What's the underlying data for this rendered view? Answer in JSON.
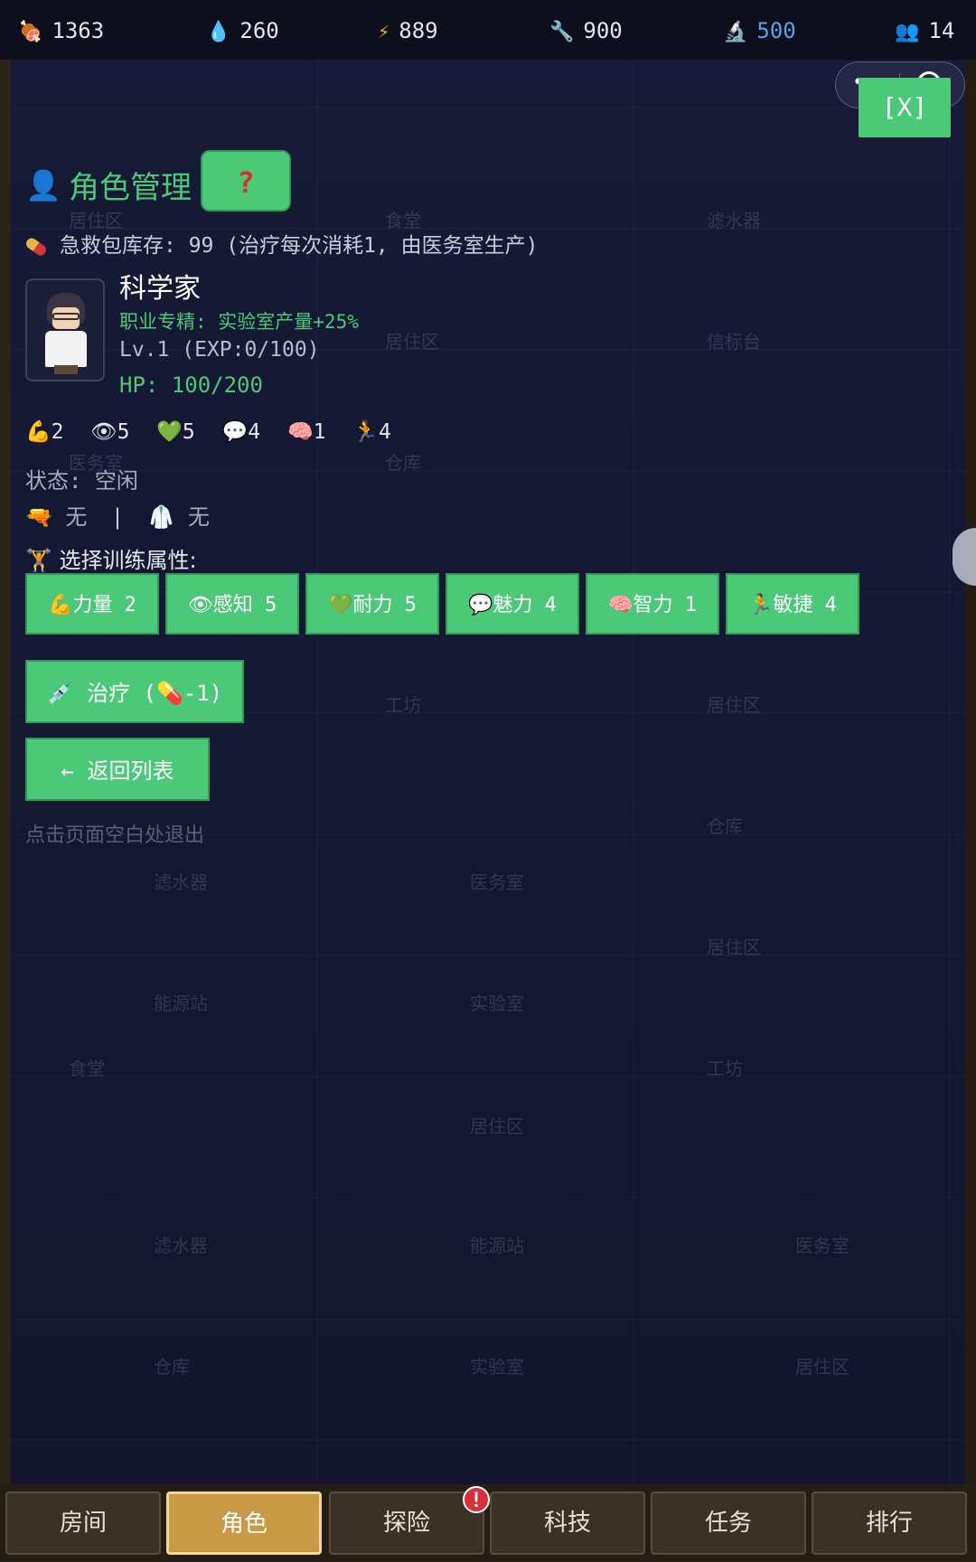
{
  "resources": [
    {
      "icon": "meat-icon",
      "value": "1363"
    },
    {
      "icon": "water-drop-icon",
      "value": "260"
    },
    {
      "icon": "lightning-icon",
      "value": "889"
    },
    {
      "icon": "wrench-icon",
      "value": "900"
    },
    {
      "icon": "microscope-icon",
      "value": "500",
      "color": "#5aa2e6"
    },
    {
      "icon": "people-icon",
      "value": "14"
    }
  ],
  "close_label": "[X]",
  "panel": {
    "title": "角色管理",
    "help_label": "?",
    "firstaid_text": "急救包库存: 99 (治疗每次消耗1, 由医务室生产)",
    "character": {
      "name": "科学家",
      "specialty": "职业专精: 实验室产量+25%",
      "level": "Lv.1 (EXP:0/100)",
      "hp": "HP: 100/200"
    },
    "stats": [
      {
        "icon": "💪",
        "value": "2"
      },
      {
        "icon": "👁",
        "value": "5"
      },
      {
        "icon": "💚",
        "value": "5"
      },
      {
        "icon": "💬",
        "value": "4"
      },
      {
        "icon": "🧠",
        "value": "1"
      },
      {
        "icon": "🏃",
        "value": "4"
      }
    ],
    "status": "状态: 空闲",
    "weapon": "无",
    "armor": "无",
    "train_label": "选择训练属性:",
    "train_buttons": [
      "💪力量 2",
      "👁感知 5",
      "💚耐力 5",
      "💬魅力 4",
      "🧠智力 1",
      "🏃敏捷 4"
    ],
    "heal_label": "💉 治疗 (💊-1)",
    "back_label": "← 返回列表",
    "hint": "点击页面空白处退出"
  },
  "tabs": [
    {
      "label": "房间",
      "active": false
    },
    {
      "label": "角色",
      "active": true
    },
    {
      "label": "探险",
      "active": false
    },
    {
      "label": "科技",
      "active": false
    },
    {
      "label": "任务",
      "active": false
    },
    {
      "label": "排行",
      "active": false
    }
  ],
  "tab_badge": "!",
  "background_rooms": [
    "居住区",
    "食堂",
    "滤水器",
    "居住区",
    "信标台",
    "医务室",
    "仓库",
    "工坊",
    "居住区",
    "滤水器",
    "医务室",
    "仓库",
    "能源站",
    "实验室",
    "居住区",
    "食堂",
    "工坊",
    "居住区",
    "滤水器",
    "能源站",
    "医务室",
    "仓库",
    "实验室",
    "居住区"
  ]
}
